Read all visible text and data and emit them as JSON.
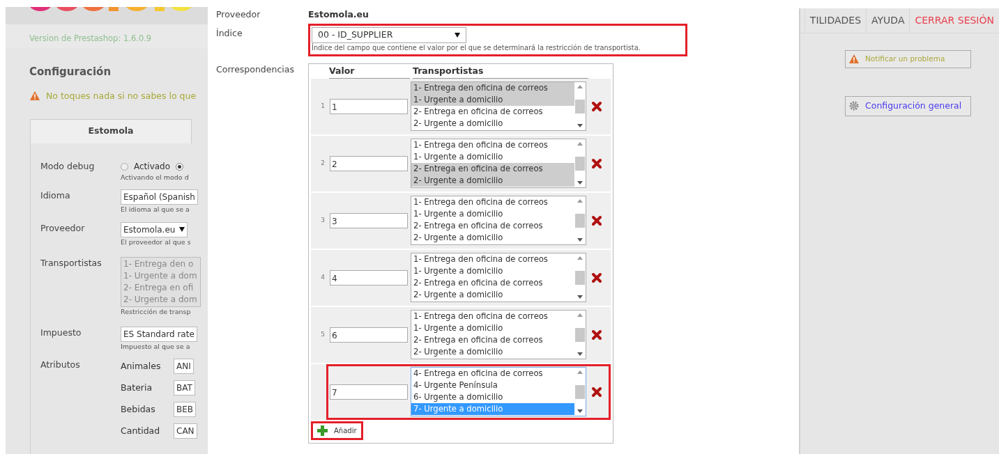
{
  "left_panel": {
    "version": "Version de Prestashop: 1.6.0.9",
    "heading": "Configuración",
    "warning": "No toques nada si no sabes lo que",
    "tab": "Estomola",
    "form": [
      {
        "kind": "radio",
        "label": "Modo debug",
        "options": [
          {
            "label": "Activado",
            "selected": false
          },
          {
            "selected": true
          }
        ],
        "help": "Activando el modo d"
      },
      {
        "kind": "select",
        "label": "Idioma",
        "value": "Español (Spanish",
        "help": "El idioma al que se a"
      },
      {
        "kind": "dropdown",
        "label": "Proveedor",
        "value": "Estomola.eu",
        "help": "El proveedor al que s"
      },
      {
        "kind": "listbox",
        "label": "Transportistas",
        "options": [
          "1- Entrega den o",
          "1- Urgente a dom",
          "2- Entrega en ofi",
          "2- Urgente a dom"
        ],
        "help": "Restricción de transp"
      },
      {
        "kind": "select",
        "label": "Impuesto",
        "value": "ES Standard rate",
        "help": "Impuesto al que se a"
      },
      {
        "kind": "attributes",
        "label": "Atributos",
        "items": [
          {
            "label": "Animales",
            "value": "ANI"
          },
          {
            "label": "Bateria",
            "value": "BAT"
          },
          {
            "label": "Bebidas",
            "value": "BEB"
          },
          {
            "label": "Cantidad",
            "value": "CAN"
          }
        ]
      }
    ]
  },
  "modal": {
    "supplier_label": "Proveedor",
    "supplier_value": "Estomola.eu",
    "index": {
      "label": "Índice",
      "value": "00 - ID_SUPPLIER",
      "help": "Índice del campo que contiene el valor por el que se determinará la restricción de transportista.",
      "highlighted": true
    },
    "correspondences": {
      "label": "Correspondencias",
      "columns": [
        "Valor",
        "Transportistas"
      ],
      "rows": [
        {
          "number": "1",
          "value": "1",
          "focused": false,
          "highlighted": false,
          "options": [
            {
              "label": "1- Entrega den oficina de correos",
              "selected": true
            },
            {
              "label": "1- Urgente a domicilio",
              "selected": true
            },
            {
              "label": "2- Entrega en oficina de correos",
              "selected": false
            },
            {
              "label": "2- Urgente a domicilio",
              "selected": false
            }
          ]
        },
        {
          "number": "2",
          "value": "2",
          "focused": false,
          "highlighted": false,
          "options": [
            {
              "label": "1- Entrega den oficina de correos",
              "selected": false
            },
            {
              "label": "1- Urgente a domicilio",
              "selected": false
            },
            {
              "label": "2- Entrega en oficina de correos",
              "selected": true
            },
            {
              "label": "2- Urgente a domicilio",
              "selected": true
            }
          ]
        },
        {
          "number": "3",
          "value": "3",
          "focused": false,
          "highlighted": false,
          "options": [
            {
              "label": "1- Entrega den oficina de correos",
              "selected": false
            },
            {
              "label": "1- Urgente a domicilio",
              "selected": false
            },
            {
              "label": "2- Entrega en oficina de correos",
              "selected": false
            },
            {
              "label": "2- Urgente a domicilio",
              "selected": false
            }
          ]
        },
        {
          "number": "4",
          "value": "4",
          "focused": false,
          "highlighted": false,
          "options": [
            {
              "label": "1- Entrega den oficina de correos",
              "selected": false
            },
            {
              "label": "1- Urgente a domicilio",
              "selected": false
            },
            {
              "label": "2- Entrega en oficina de correos",
              "selected": false
            },
            {
              "label": "2- Urgente a domicilio",
              "selected": false
            }
          ]
        },
        {
          "number": "5",
          "value": "6",
          "focused": false,
          "highlighted": false,
          "options": [
            {
              "label": "1- Entrega den oficina de correos",
              "selected": false
            },
            {
              "label": "1- Urgente a domicilio",
              "selected": false
            },
            {
              "label": "2- Entrega en oficina de correos",
              "selected": false
            },
            {
              "label": "2- Urgente a domicilio",
              "selected": false
            }
          ]
        },
        {
          "value": "7",
          "focused": true,
          "highlighted": true,
          "options": [
            {
              "label": "4- Entrega en oficina de correos",
              "selected": false
            },
            {
              "label": "4- Urgente Península",
              "selected": false
            },
            {
              "label": "6- Urgente a domicilio",
              "selected": false
            },
            {
              "label": "7- Urgente a domicilio",
              "selected": true
            }
          ]
        }
      ],
      "add_button": {
        "label": "Añadir",
        "highlighted": true
      }
    }
  },
  "right_panel": {
    "nav": [
      {
        "label": "TILIDADES",
        "kind": "normal"
      },
      {
        "label": "AYUDA",
        "kind": "normal"
      },
      {
        "label": "CERRAR SESIÓN",
        "kind": "logout"
      }
    ],
    "buttons": [
      {
        "label": "Notificar un problema",
        "kind": "warning"
      },
      {
        "label": "Configuración general",
        "kind": "settings"
      }
    ]
  }
}
